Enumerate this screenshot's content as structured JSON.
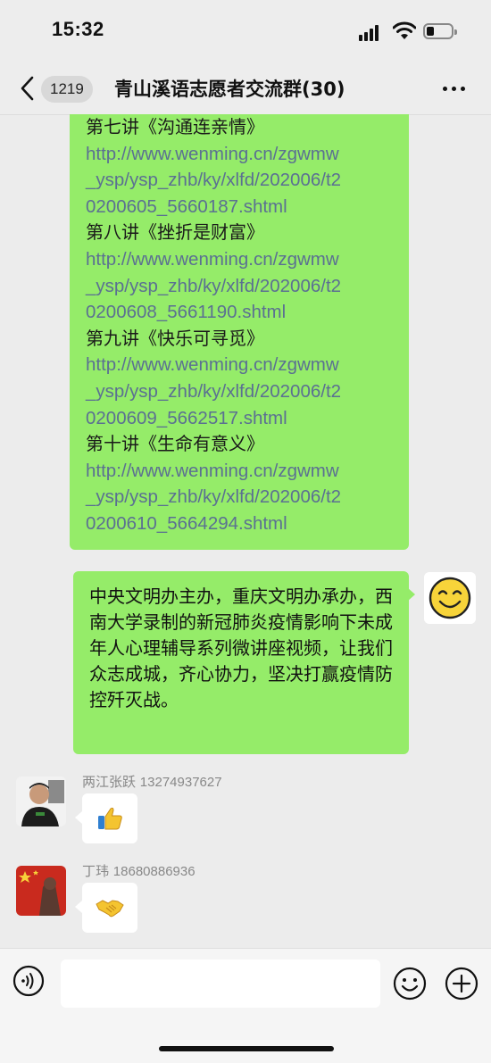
{
  "status_bar": {
    "time": "15:32"
  },
  "nav": {
    "unread_count": "1219",
    "title": "青山溪语志愿者交流群(30)"
  },
  "messages": {
    "links_message": {
      "lines": [
        {
          "kind": "heading",
          "text": "第七讲《沟通连亲情》"
        },
        {
          "kind": "link",
          "text": "http://www.wenming.cn/zgwmw"
        },
        {
          "kind": "link",
          "text": "_ysp/ysp_zhb/ky/xlfd/202006/t2"
        },
        {
          "kind": "link",
          "text": "0200605_5660187.shtml"
        },
        {
          "kind": "heading",
          "text": "第八讲《挫折是财富》"
        },
        {
          "kind": "link",
          "text": "http://www.wenming.cn/zgwmw"
        },
        {
          "kind": "link",
          "text": "_ysp/ysp_zhb/ky/xlfd/202006/t2"
        },
        {
          "kind": "link",
          "text": "0200608_5661190.shtml"
        },
        {
          "kind": "heading",
          "text": "第九讲《快乐可寻觅》"
        },
        {
          "kind": "link",
          "text": "http://www.wenming.cn/zgwmw"
        },
        {
          "kind": "link",
          "text": "_ysp/ysp_zhb/ky/xlfd/202006/t2"
        },
        {
          "kind": "link",
          "text": "0200609_5662517.shtml"
        },
        {
          "kind": "heading",
          "text": "第十讲《生命有意义》"
        },
        {
          "kind": "link",
          "text": "http://www.wenming.cn/zgwmw"
        },
        {
          "kind": "link",
          "text": "_ysp/ysp_zhb/ky/xlfd/202006/t2"
        },
        {
          "kind": "link",
          "text": "0200610_5664294.shtml"
        }
      ]
    },
    "announcement": {
      "text": "中央文明办主办，重庆文明办承办，西南大学录制的新冠肺炎疫情影响下未成年人心理辅导系列微讲座视频，让我们众志成城，齐心协力，坚决打赢疫情防控歼灭战。"
    },
    "reply_1": {
      "sender_name": "两江张跃",
      "sender_phone": "13274937627",
      "content_icon": "thumbs-up-emoji"
    },
    "reply_2": {
      "sender_name": "丁玮",
      "sender_phone": "18680886936",
      "content_icon": "handshake-emoji"
    }
  },
  "input_bar": {
    "placeholder": ""
  },
  "colors": {
    "background": "#ececec",
    "sent_bubble": "#95ec69",
    "link_text": "#5b7092",
    "received_bubble": "#ffffff"
  }
}
